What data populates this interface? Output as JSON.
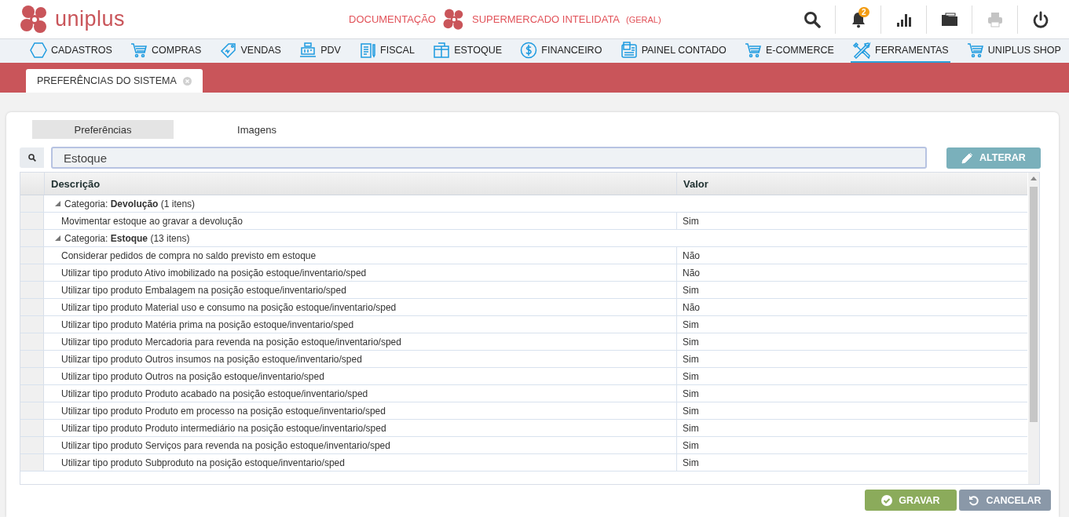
{
  "header": {
    "brand": "uniplus",
    "documentation_link": "DOCUMENTAÇÃO",
    "company": "SUPERMERCADO INTELIDATA",
    "company_scope": "(GERAL)",
    "toolbar": [
      {
        "disabled": false
      },
      {
        "disabled": false,
        "badge": "2"
      },
      {
        "disabled": false
      },
      {
        "disabled": false
      },
      {
        "disabled": true
      },
      {
        "disabled": false
      }
    ]
  },
  "menu": [
    {
      "label": "CADASTROS",
      "selected": false
    },
    {
      "label": "COMPRAS",
      "selected": false
    },
    {
      "label": "VENDAS",
      "selected": false
    },
    {
      "label": "PDV",
      "selected": false
    },
    {
      "label": "FISCAL",
      "selected": false
    },
    {
      "label": "ESTOQUE",
      "selected": false
    },
    {
      "label": "FINANCEIRO",
      "selected": false
    },
    {
      "label": "PAINEL CONTADO",
      "selected": false
    },
    {
      "label": "E-COMMERCE",
      "selected": false
    },
    {
      "label": "FERRAMENTAS",
      "selected": true
    },
    {
      "label": "UNIPLUS SHOP",
      "selected": false
    }
  ],
  "open_tabs": [
    {
      "label": "PREFERÊNCIAS DO SISTEMA",
      "selected": true
    }
  ],
  "panel": {
    "tabs": [
      {
        "label": "Preferências",
        "selected": true
      },
      {
        "label": "Imagens",
        "selected": false
      }
    ],
    "search": {
      "value": "Estoque"
    },
    "edit_button": "ALTERAR",
    "table": {
      "columns": [
        "Descrição",
        "Valor"
      ],
      "rows": [
        {
          "kind": "group",
          "text": "Categoria: **Devolução** (1 itens)",
          "expanded": true
        },
        {
          "kind": "item",
          "description": "Movimentar estoque ao gravar a devolução",
          "value": "Sim"
        },
        {
          "kind": "group",
          "text": "Categoria: **Estoque** (13 itens)",
          "expanded": true
        },
        {
          "kind": "item",
          "description": "Considerar pedidos de compra no saldo previsto em estoque",
          "value": "Não"
        },
        {
          "kind": "item",
          "description": "Utilizar tipo produto Ativo imobilizado na posição estoque/inventario/sped",
          "value": "Não"
        },
        {
          "kind": "item",
          "description": "Utilizar tipo produto Embalagem na posição estoque/inventario/sped",
          "value": "Sim"
        },
        {
          "kind": "item",
          "description": "Utilizar tipo produto Material uso e consumo na posição estoque/inventario/sped",
          "value": "Não"
        },
        {
          "kind": "item",
          "description": "Utilizar tipo produto Matéria prima na posição estoque/inventario/sped",
          "value": "Sim"
        },
        {
          "kind": "item",
          "description": "Utilizar tipo produto Mercadoria para revenda na posição estoque/inventario/sped",
          "value": "Sim"
        },
        {
          "kind": "item",
          "description": "Utilizar tipo produto Outros insumos na posição estoque/inventario/sped",
          "value": "Sim"
        },
        {
          "kind": "item",
          "description": "Utilizar tipo produto Outros na posição estoque/inventario/sped",
          "value": "Sim"
        },
        {
          "kind": "item",
          "description": "Utilizar tipo produto Produto acabado na posição estoque/inventario/sped",
          "value": "Sim"
        },
        {
          "kind": "item",
          "description": "Utilizar tipo produto Produto em processo na posição estoque/inventario/sped",
          "value": "Sim"
        },
        {
          "kind": "item",
          "description": "Utilizar tipo produto Produto intermediário na posição estoque/inventario/sped",
          "value": "Sim"
        },
        {
          "kind": "item",
          "description": "Utilizar tipo produto Serviços para revenda na posição estoque/inventario/sped",
          "value": "Sim"
        },
        {
          "kind": "item",
          "description": "Utilizar tipo produto Subproduto na posição estoque/inventario/sped",
          "value": "Sim"
        }
      ]
    }
  },
  "footer_buttons": [
    {
      "kind": "save",
      "label": "GRAVAR"
    },
    {
      "kind": "cancel",
      "label": "CANCELAR"
    }
  ]
}
